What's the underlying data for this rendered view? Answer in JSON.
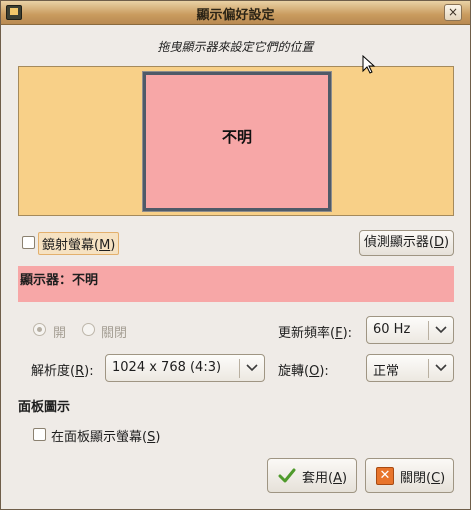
{
  "window": {
    "title": "顯示偏好設定",
    "close_glyph": "×"
  },
  "instruction": "拖曳顯示器來設定它們的位置",
  "monitor_area": {
    "monitor_label": "不明"
  },
  "mirror": {
    "label_prefix": "鏡射螢幕(",
    "mnemonic": "M",
    "label_suffix": ")",
    "checked": false
  },
  "detect_button": {
    "label_prefix": "偵測顯示器(",
    "mnemonic": "D",
    "label_suffix": ")"
  },
  "monitor_header": "顯示器：不明",
  "power": {
    "on_label": "開",
    "off_label": "關閉",
    "selected": "on"
  },
  "refresh_rate": {
    "label_prefix": "更新頻率(",
    "mnemonic": "F",
    "label_suffix": "):",
    "value": "60 Hz"
  },
  "resolution": {
    "label_prefix": "解析度(",
    "mnemonic": "R",
    "label_suffix": "):",
    "value": "1024 x 768 (4:3)"
  },
  "rotation": {
    "label_prefix": "旋轉(",
    "mnemonic": "O",
    "label_suffix": "):",
    "value": "正常"
  },
  "panel_section": {
    "title": "面板圖示",
    "checkbox_prefix": "在面板顯示螢幕(",
    "mnemonic": "S",
    "checkbox_suffix": ")",
    "checked": false
  },
  "buttons": {
    "apply_prefix": "套用(",
    "apply_mnemonic": "A",
    "apply_suffix": ")",
    "close_prefix": "關閉(",
    "close_mnemonic": "C",
    "close_suffix": ")",
    "close_glyph": "✕"
  },
  "colors": {
    "monitor_fill": "#f7a7a7",
    "arrange_area": "#f8d088",
    "titlebar": "#c99b5e",
    "window_bg": "#efebe7"
  },
  "icons": [
    "app-icon",
    "close-icon",
    "chevron-down-icon",
    "check-icon",
    "x-icon",
    "mouse-cursor-icon"
  ]
}
